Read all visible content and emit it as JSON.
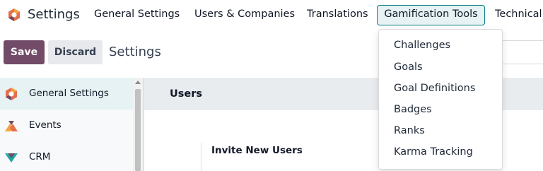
{
  "navbar": {
    "app_name": "Settings",
    "menu": [
      {
        "label": "General Settings"
      },
      {
        "label": "Users & Companies"
      },
      {
        "label": "Translations"
      },
      {
        "label": "Gamification Tools"
      },
      {
        "label": "Technical"
      }
    ],
    "active_menu_index": 3,
    "logo_icon": "odoo-settings-logo-icon"
  },
  "control_panel": {
    "save_label": "Save",
    "discard_label": "Discard",
    "breadcrumb": "Settings"
  },
  "dropdown": {
    "items": [
      {
        "label": "Challenges"
      },
      {
        "label": "Goals"
      },
      {
        "label": "Goal Definitions"
      },
      {
        "label": "Badges"
      },
      {
        "label": "Ranks"
      },
      {
        "label": "Karma Tracking"
      }
    ]
  },
  "sidebar": {
    "items": [
      {
        "label": "General Settings",
        "icon": "settings-gear-icon",
        "active": true
      },
      {
        "label": "Events",
        "icon": "events-icon"
      },
      {
        "label": "CRM",
        "icon": "crm-icon"
      }
    ]
  },
  "content": {
    "section_title": "Users",
    "setting_title": "Invite New Users"
  },
  "colors": {
    "brand": "#714b67",
    "accent": "#017e84",
    "active_bg": "#e6f2f3"
  }
}
